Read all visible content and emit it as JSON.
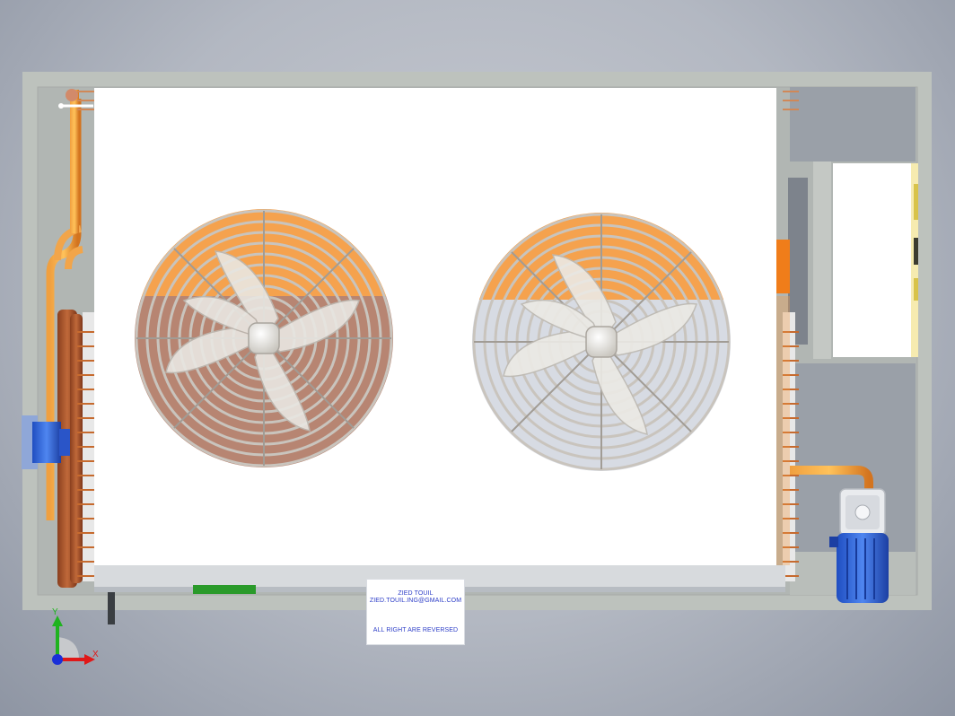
{
  "model": {
    "name": "Condensing unit – top view",
    "fan_count": 2
  },
  "title_block": {
    "author": "ZIED TOUIL",
    "email": "ZIED.TOUIL.ING@GMAIL.COM",
    "rights": "ALL RIGHT ARE REVERSED"
  },
  "triad": {
    "x_label": "X",
    "y_label": "Y"
  },
  "colors": {
    "frame": "#bfc4bf",
    "panel": "#ffffff",
    "copper": "#e8892a",
    "copper_dark": "#a9542a",
    "fan_guard": "#b9b4ad",
    "motor_blue": "#2b63d9",
    "triad_x": "#e01818",
    "triad_y": "#1fb31f",
    "triad_z": "#1a2fd8",
    "text_blue": "#2b3cc7"
  },
  "icons": [
    "fan-guard-icon",
    "compressor-icon",
    "coordinate-triad-icon"
  ]
}
